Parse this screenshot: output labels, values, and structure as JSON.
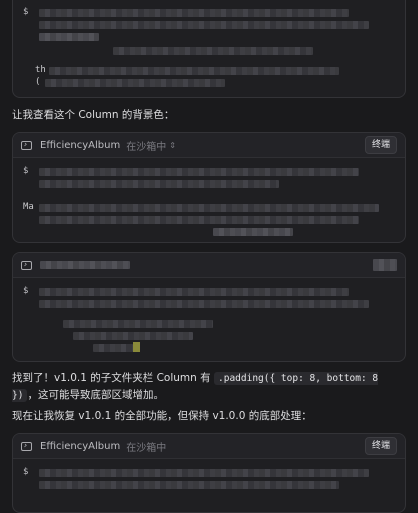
{
  "block1": {
    "prompt": "$",
    "line_prefix_1": "th",
    "line_prefix_2": "("
  },
  "message1": "让我查看这个 Column 的背景色：",
  "block2": {
    "title": "EfficiencyAlbum",
    "sandbox": "在沙箱中",
    "button": "终端",
    "prompt": "$",
    "line_prefix": "Ma"
  },
  "block3": {
    "prompt": "$"
  },
  "message2": {
    "before": "找到了！v1.0.1 的子文件夹栏 Column 有 ",
    "code": ".padding({ top: 8, bottom: 8 })",
    "after": "，这可能导致底部区域增加。"
  },
  "message3": "现在让我恢复 v1.0.1 的全部功能，但保持 v1.0.0 的底部处理：",
  "block4": {
    "title": "EfficiencyAlbum",
    "sandbox": "在沙箱中",
    "button": "终端",
    "prompt": "$"
  },
  "icons": {
    "terminal": "terminal-icon",
    "chevron": "chevron-updown-icon"
  }
}
